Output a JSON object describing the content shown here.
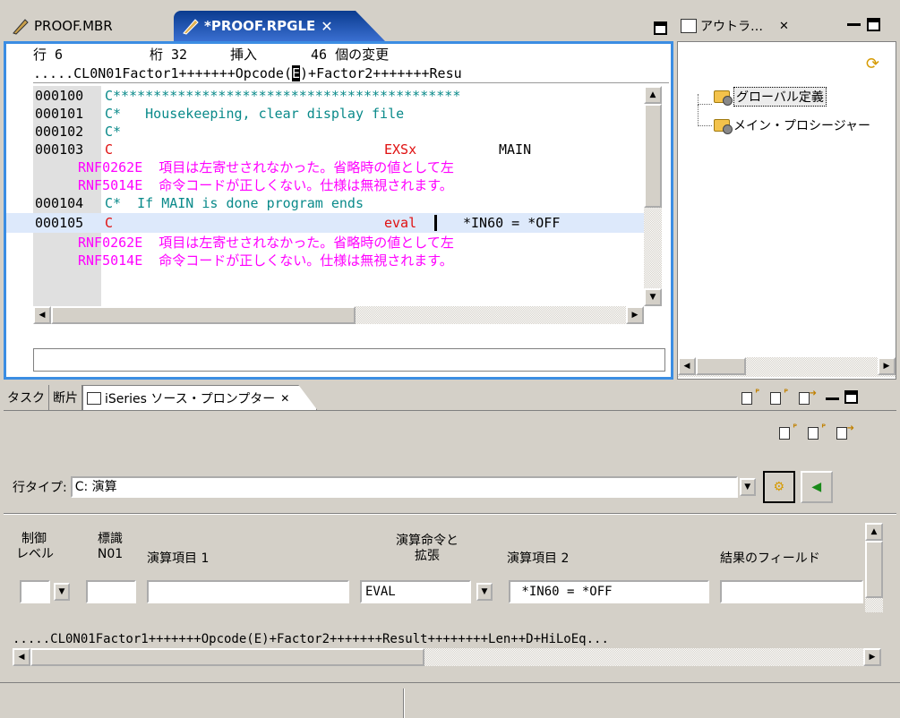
{
  "editor": {
    "tabs": [
      {
        "label": "PROOF.MBR",
        "active": false
      },
      {
        "label": "*PROOF.RPGLE",
        "active": true
      }
    ],
    "status": {
      "row_label": "行 6",
      "col_label": "桁 32",
      "mode": "挿入",
      "changes": "46 個の変更"
    },
    "ruler_before": ".....CL0N01Factor1+++++++Opcode(",
    "ruler_cursor": "E",
    "ruler_after": ")+Factor2+++++++Resu",
    "lines": [
      {
        "seq": "000100",
        "code": "C*******************************************",
        "color": "green"
      },
      {
        "seq": "000101",
        "code": "C*   Housekeeping, clear display file",
        "color": "green"
      },
      {
        "seq": "000102",
        "code": "C*",
        "color": "green"
      },
      {
        "seq": "000103",
        "code_c": "C",
        "code_op": "EXSx",
        "code_f2": "MAIN"
      },
      {
        "msg": "RNF0262E  項目は左寄せされなかった。省略時の値として左"
      },
      {
        "msg": "RNF5014E  命令コードが正しくない。仕様は無視されます。"
      },
      {
        "seq": "000104",
        "code": "C*  If MAIN is done program ends",
        "color": "green"
      },
      {
        "seq": "000105",
        "code_c": "C",
        "code_op": "eval",
        "code_f2": "*IN60 = *OFF"
      },
      {
        "msg": "RNF0262E  項目は左寄せされなかった。省略時の値として左"
      },
      {
        "msg": "RNF5014E  命令コードが正しくない。仕様は無視されます。"
      }
    ]
  },
  "outline": {
    "tab_label": "アウトラ…",
    "items": [
      "グローバル定義",
      "メイン・プロシージャー"
    ]
  },
  "prompter": {
    "tabs": [
      "タスク",
      "断片",
      "iSeries ソース・プロンプター"
    ],
    "line_type_label": "行タイプ:",
    "line_type_value": "C: 演算",
    "fields": {
      "control_level": "制御\nレベル",
      "indicator": "標識\nN01",
      "factor1": "演算項目 1",
      "opcode": "演算命令と\n拡張",
      "factor2": "演算項目 2",
      "result": "結果のフィールド"
    },
    "values": {
      "opcode": "EVAL",
      "factor2": " *IN60 = *OFF"
    },
    "ruler": ".....CL0N01Factor1+++++++Opcode(E)+Factor2+++++++Result++++++++Len++D+HiLoEq..."
  }
}
